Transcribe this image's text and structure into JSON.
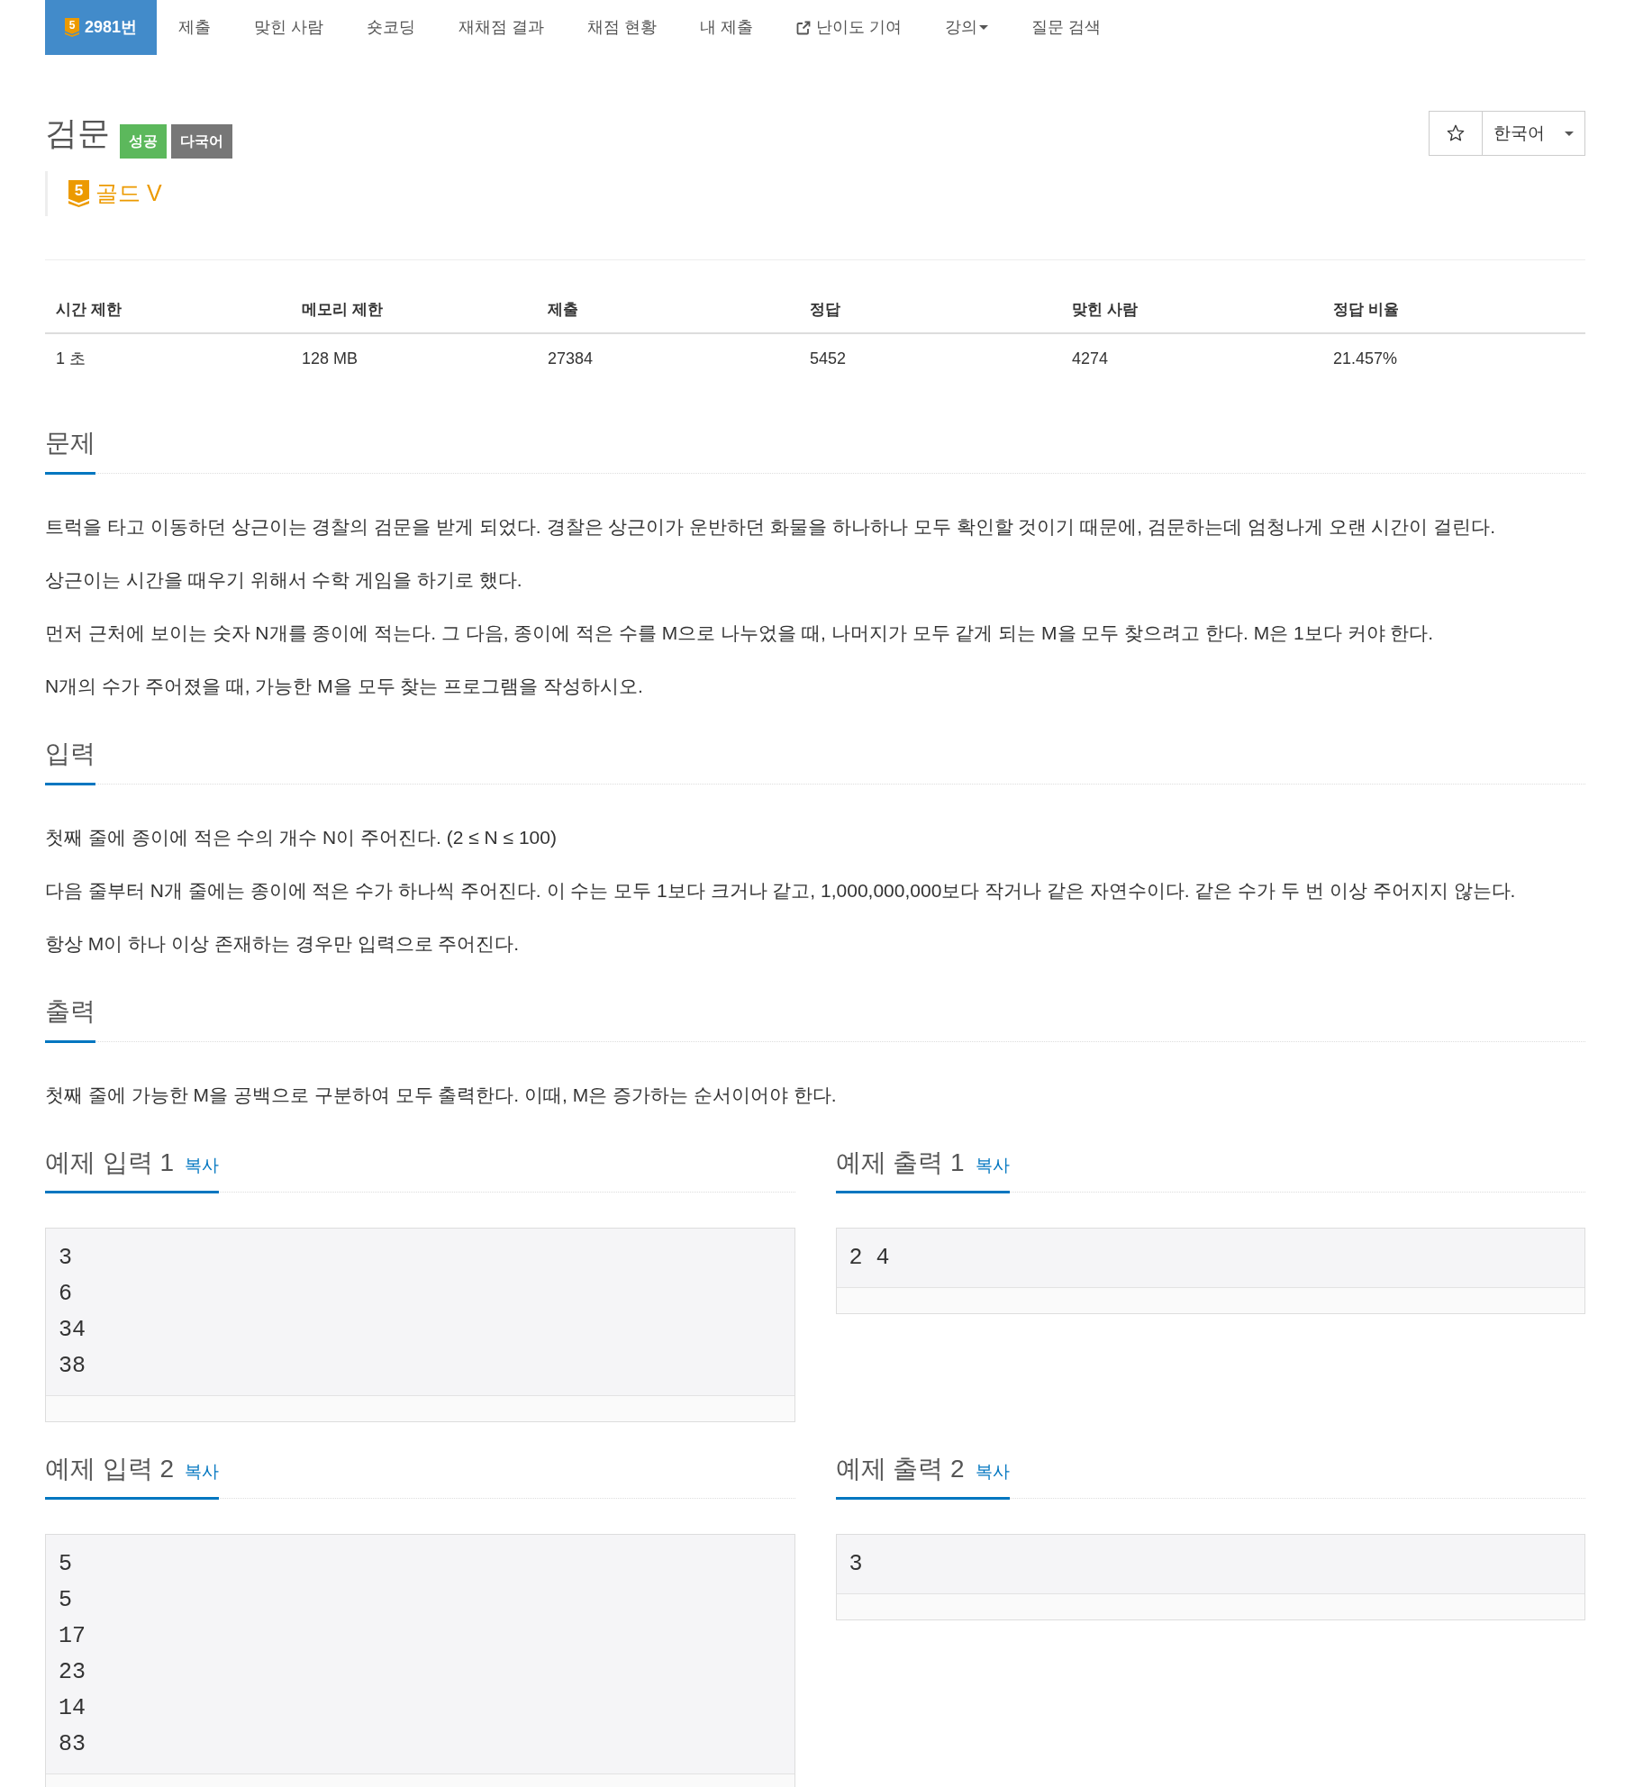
{
  "nav": {
    "items": [
      {
        "label": "2981번",
        "kind": "problem",
        "tier": "5",
        "selected": true
      },
      {
        "label": "제출",
        "kind": "link",
        "selected": false
      },
      {
        "label": "맞힌 사람",
        "kind": "link",
        "selected": false
      },
      {
        "label": "숏코딩",
        "kind": "link",
        "selected": false
      },
      {
        "label": "재채점 결과",
        "kind": "link",
        "selected": false
      },
      {
        "label": "채점 현황",
        "kind": "link",
        "selected": false
      },
      {
        "label": "내 제출",
        "kind": "link",
        "selected": false
      },
      {
        "label": "난이도 기여",
        "kind": "external",
        "selected": false
      },
      {
        "label": "강의",
        "kind": "menu",
        "selected": false
      },
      {
        "label": "질문 검색",
        "kind": "link",
        "selected": false
      }
    ]
  },
  "problem": {
    "title": "검문",
    "badges": [
      {
        "label": "성공",
        "color": "#5cb85c"
      },
      {
        "label": "다국어",
        "color": "#777777"
      }
    ],
    "tier": {
      "number": "5",
      "name": "골드 V"
    },
    "starred": false,
    "language": "한국어"
  },
  "stats": {
    "columns": [
      "시간 제한",
      "메모리 제한",
      "제출",
      "정답",
      "맞힌 사람",
      "정답 비율"
    ],
    "rows": [
      [
        "1 초",
        "128 MB",
        "27384",
        "5452",
        "4274",
        "21.457%"
      ]
    ]
  },
  "sections": [
    {
      "heading": "문제",
      "paragraphs": [
        "트럭을 타고 이동하던 상근이는 경찰의 검문을 받게 되었다. 경찰은 상근이가 운반하던 화물을 하나하나 모두 확인할 것이기 때문에, 검문하는데 엄청나게 오랜 시간이 걸린다.",
        "상근이는 시간을 때우기 위해서 수학 게임을 하기로 했다.",
        "먼저 근처에 보이는 숫자 N개를 종이에 적는다. 그 다음, 종이에 적은 수를 M으로 나누었을 때, 나머지가 모두 같게 되는 M을 모두 찾으려고 한다. M은 1보다 커야 한다.",
        "N개의 수가 주어졌을 때, 가능한 M을 모두 찾는 프로그램을 작성하시오."
      ]
    },
    {
      "heading": "입력",
      "paragraphs": [
        "첫째 줄에 종이에 적은 수의 개수 N이 주어진다. (2 ≤ N ≤ 100)",
        "다음 줄부터 N개 줄에는 종이에 적은 수가 하나씩 주어진다. 이 수는 모두 1보다 크거나 같고, 1,000,000,000보다 작거나 같은 자연수이다. 같은 수가 두 번 이상 주어지지 않는다.",
        "항상 M이 하나 이상 존재하는 경우만 입력으로 주어진다."
      ]
    },
    {
      "heading": "출력",
      "paragraphs": [
        "첫째 줄에 가능한 M을 공백으로 구분하여 모두 출력한다. 이때, M은 증가하는 순서이어야 한다."
      ]
    }
  ],
  "examples": [
    {
      "heading": "예제 입력 1",
      "copy": "복사",
      "lines": [
        "3",
        "6",
        "34",
        "38"
      ]
    },
    {
      "heading": "예제 출력 1",
      "copy": "복사",
      "lines": [
        "2 4"
      ]
    },
    {
      "heading": "예제 입력 2",
      "copy": "복사",
      "lines": [
        "5",
        "5",
        "17",
        "23",
        "14",
        "83"
      ]
    },
    {
      "heading": "예제 출력 2",
      "copy": "복사",
      "lines": [
        "3"
      ]
    }
  ]
}
